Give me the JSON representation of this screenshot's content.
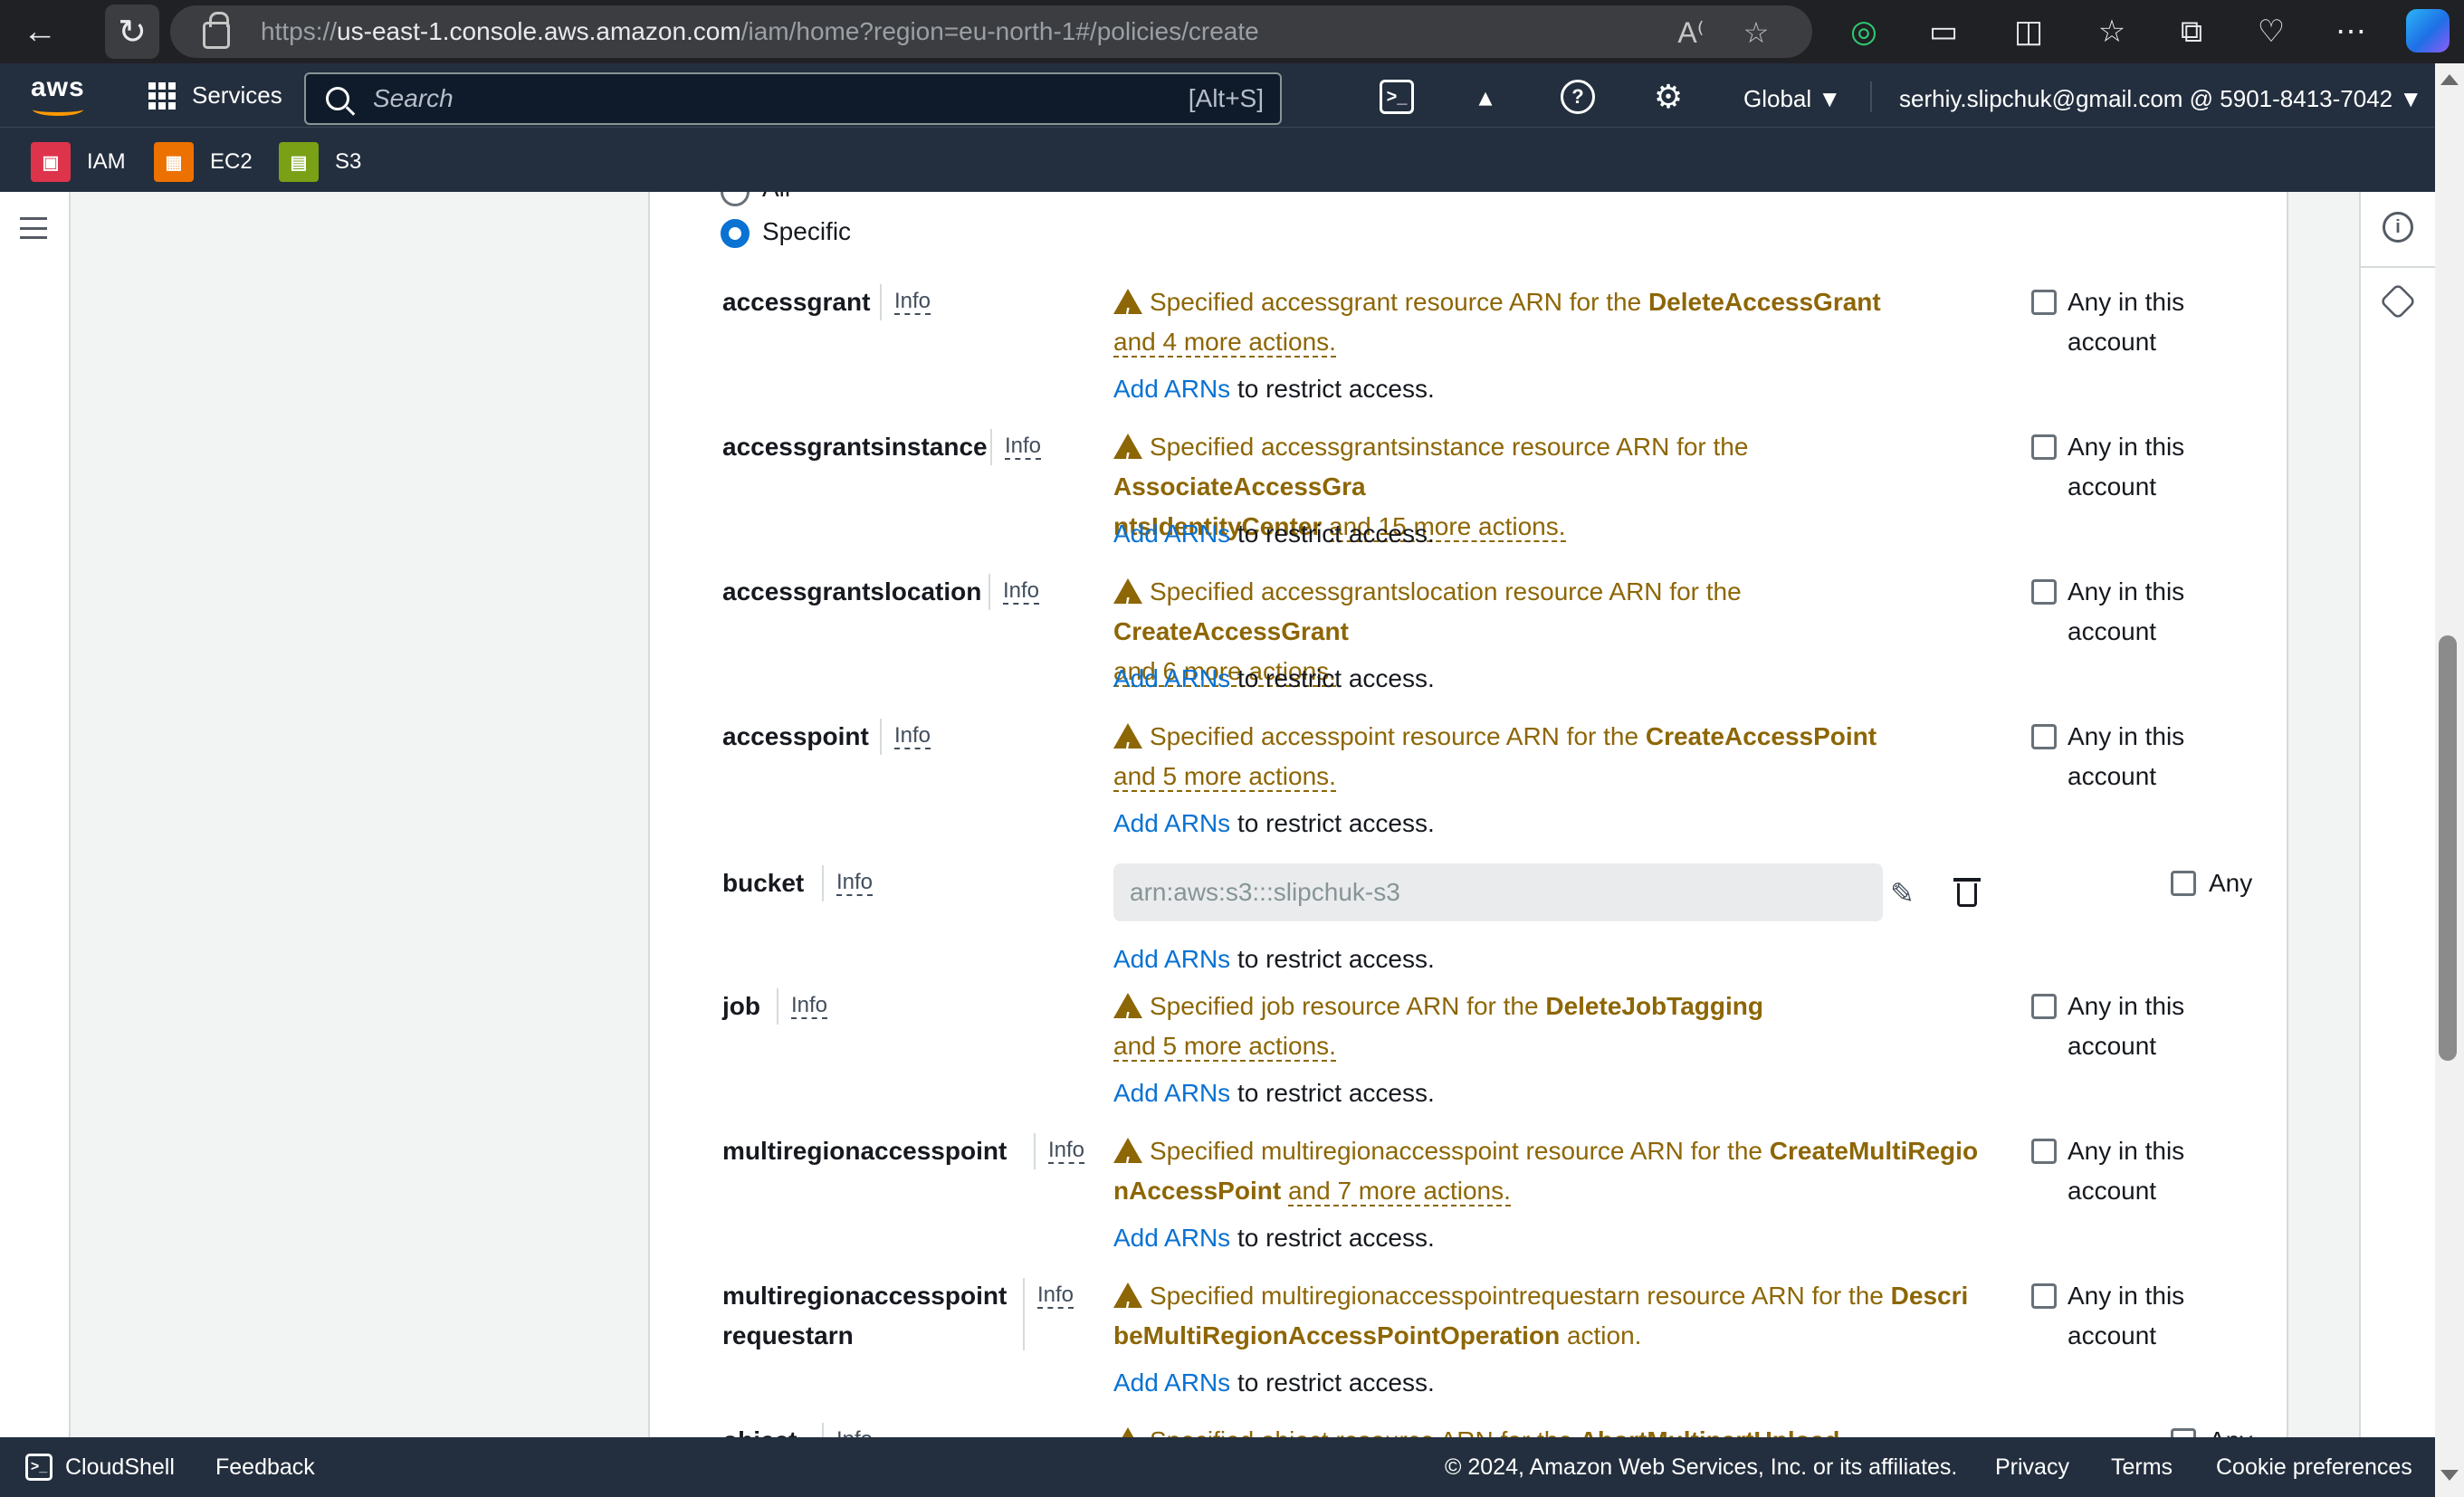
{
  "browser": {
    "url_prefix": "https://",
    "url_domain": "us-east-1.console.aws.amazon.com",
    "url_path": "/iam/home?region=eu-north-1#/policies/create"
  },
  "aws_header": {
    "logo": "aws",
    "services_label": "Services",
    "search_placeholder": "Search",
    "search_shortcut": "[Alt+S]",
    "region": "Global ▼",
    "account": "serhiy.slipchuk@gmail.com @ 5901-8413-7042 ▼"
  },
  "favorites": [
    {
      "label": "IAM",
      "color": "#dd344c"
    },
    {
      "label": "EC2",
      "color": "#ed7100"
    },
    {
      "label": "S3",
      "color": "#7aa116"
    }
  ],
  "radio_options": {
    "all": "All",
    "specific": "Specific"
  },
  "common": {
    "info": "Info",
    "add_arns": "Add ARNs",
    "restrict": " to restrict access.",
    "any_in_account": "Any in this account",
    "any": "Any"
  },
  "resources": [
    {
      "name": "accessgrant",
      "warn_pre": "Specified accessgrant resource ARN for the ",
      "action": "DeleteAccessGrant",
      "warn_line2": "",
      "more": "and 4 more actions.",
      "tail": ""
    },
    {
      "name": "accessgrantsinstance",
      "warn_pre": "Specified accessgrantsinstance resource ARN for the ",
      "action": "AssociateAccessGra",
      "warn_line2": "ntsIdentityCenter",
      "more": "and 15 more actions.",
      "tail": ""
    },
    {
      "name": "accessgrantslocation",
      "warn_pre": "Specified accessgrantslocation resource ARN for the ",
      "action": "CreateAccessGrant",
      "warn_line2": "",
      "more": "and 6 more actions.",
      "tail": ""
    },
    {
      "name": "accesspoint",
      "warn_pre": "Specified accesspoint resource ARN for the ",
      "action": "CreateAccessPoint",
      "warn_line2": "",
      "more": "and 5 more actions.",
      "tail": ""
    },
    {
      "name": "job",
      "warn_pre": "Specified job resource ARN for the ",
      "action": "DeleteJobTagging",
      "warn_line2": "",
      "more": "and 5 more actions.",
      "tail": ""
    },
    {
      "name": "multiregionaccesspoint",
      "warn_pre": "Specified multiregionaccesspoint resource ARN for the ",
      "action": "CreateMultiRegio",
      "warn_line2": "nAccessPoint",
      "more": "and 7 more actions.",
      "tail": ""
    },
    {
      "name": "multiregionaccesspoint",
      "name2": "requestarn",
      "warn_pre": "Specified multiregionaccesspointrequestarn resource ARN for the ",
      "action": "Descri",
      "warn_line2": "beMultiRegionAccessPointOperation",
      "more": "",
      "tail": " action."
    },
    {
      "name": "object",
      "warn_pre": "Specified object resource ARN for the ",
      "action": "AbortMultipartUpload",
      "warn_line2": "",
      "more": "",
      "tail": ""
    }
  ],
  "bucket": {
    "name": "bucket",
    "arn_value": "arn:aws:s3:::slipchuk-s3"
  },
  "footer": {
    "cloudshell": "CloudShell",
    "feedback": "Feedback",
    "copyright": "© 2024, Amazon Web Services, Inc. or its affiliates.",
    "privacy": "Privacy",
    "terms": "Terms",
    "cookies": "Cookie preferences"
  }
}
